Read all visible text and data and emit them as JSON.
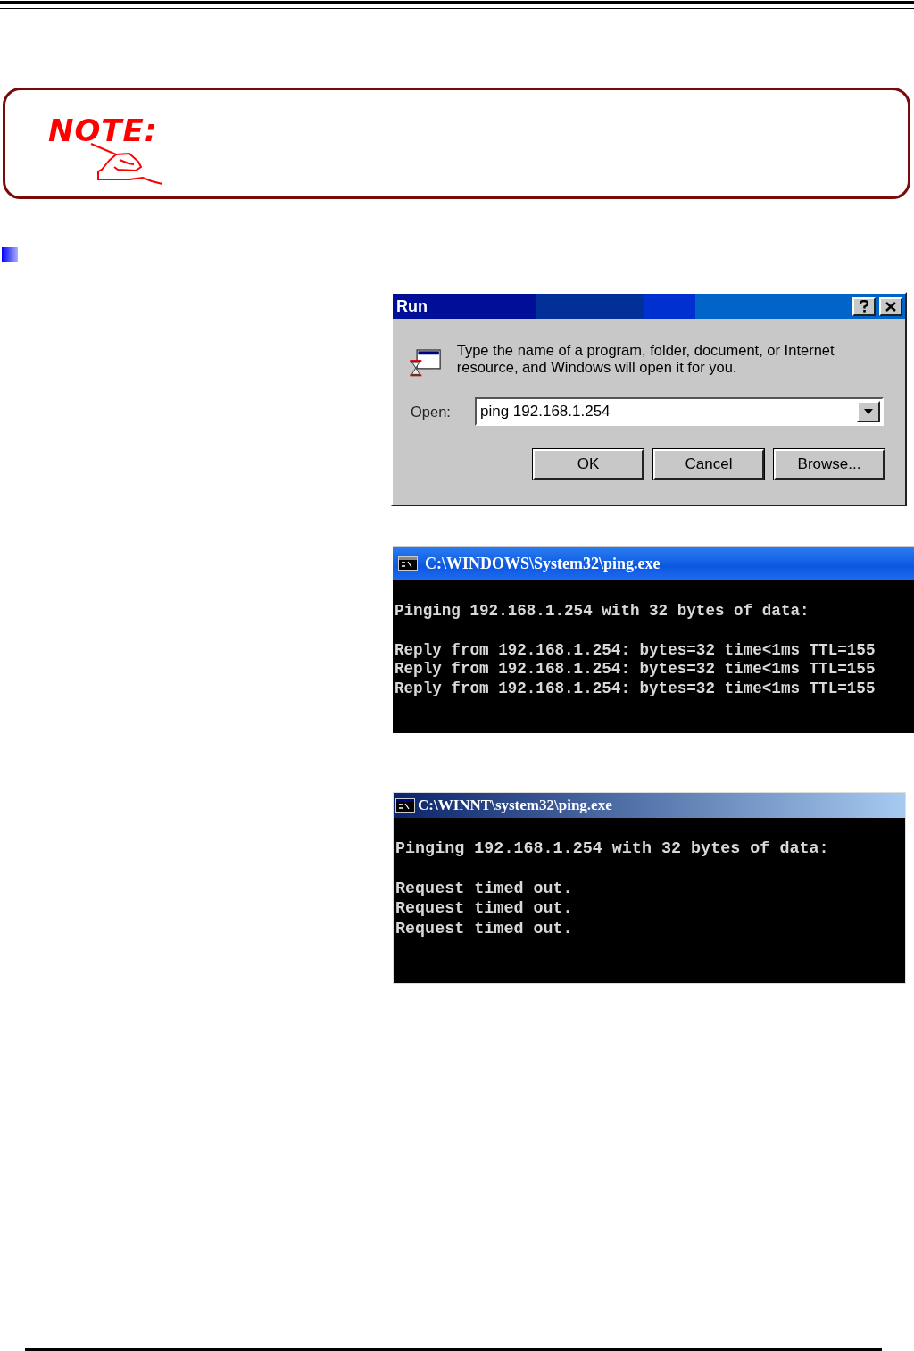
{
  "note": {
    "label": "NOTE:"
  },
  "run_dialog": {
    "title": "Run",
    "description": "Type the name of a program, folder, document, or Internet resource, and Windows will open it for you.",
    "open_label": "Open:",
    "open_value": "ping 192.168.1.254",
    "buttons": [
      "OK",
      "Cancel",
      "Browse..."
    ]
  },
  "consoles": [
    {
      "kind": "xp",
      "title": "C:\\WINDOWS\\System32\\ping.exe",
      "header": "Pinging 192.168.1.254 with 32 bytes of data:",
      "lines": [
        "Reply from 192.168.1.254: bytes=32 time<1ms TTL=155",
        "Reply from 192.168.1.254: bytes=32 time<1ms TTL=155",
        "Reply from 192.168.1.254: bytes=32 time<1ms TTL=155"
      ]
    },
    {
      "kind": "classic",
      "title": "C:\\WINNT\\system32\\ping.exe",
      "header": "Pinging 192.168.1.254 with 32 bytes of data:",
      "lines": [
        "Request timed out.",
        "Request timed out.",
        "Request timed out."
      ]
    }
  ]
}
